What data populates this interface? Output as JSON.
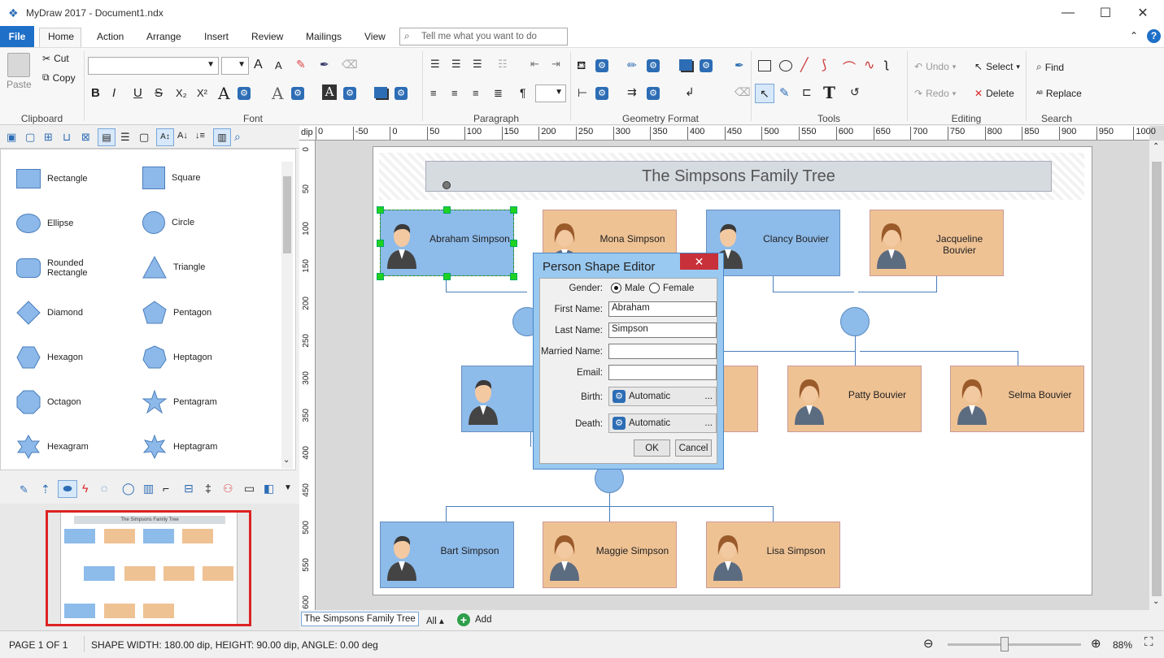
{
  "app": {
    "title": "MyDraw 2017 - Document1.ndx",
    "minimize": "—",
    "maximize": "☐",
    "close": "✕"
  },
  "menu": {
    "file": "File",
    "tabs": [
      "Home",
      "Action",
      "Arrange",
      "Insert",
      "Review",
      "Mailings",
      "View"
    ],
    "search_placeholder": "Tell me what you want to do"
  },
  "ribbon": {
    "clipboard": {
      "label": "Clipboard",
      "paste": "Paste",
      "cut": "Cut",
      "copy": "Copy"
    },
    "font": {
      "label": "Font"
    },
    "paragraph": {
      "label": "Paragraph"
    },
    "geometry": {
      "label": "Geometry Format"
    },
    "tools": {
      "label": "Tools"
    },
    "editing": {
      "label": "Editing",
      "undo": "Undo",
      "redo": "Redo",
      "select": "Select",
      "delete": "Delete"
    },
    "search": {
      "label": "Search",
      "find": "Find",
      "replace": "Replace"
    }
  },
  "shapes": [
    {
      "name": "Rectangle"
    },
    {
      "name": "Square"
    },
    {
      "name": "Ellipse"
    },
    {
      "name": "Circle"
    },
    {
      "name": "Rounded Rectangle"
    },
    {
      "name": "Triangle"
    },
    {
      "name": "Diamond"
    },
    {
      "name": "Pentagon"
    },
    {
      "name": "Hexagon"
    },
    {
      "name": "Heptagon"
    },
    {
      "name": "Octagon"
    },
    {
      "name": "Pentagram"
    },
    {
      "name": "Hexagram"
    },
    {
      "name": "Heptagram"
    }
  ],
  "ruler": {
    "unit": "dip",
    "top": [
      "0",
      "-50",
      "0",
      "50",
      "100",
      "150",
      "200",
      "250",
      "300",
      "350",
      "400",
      "450",
      "500",
      "550",
      "600",
      "650",
      "700",
      "750",
      "800",
      "850",
      "900",
      "950",
      "1000"
    ],
    "left": [
      "0",
      "50",
      "100",
      "150",
      "200",
      "250",
      "300",
      "350",
      "400",
      "450",
      "500",
      "550",
      "600"
    ]
  },
  "diagram": {
    "title": "The Simpsons Family Tree",
    "people": [
      {
        "name": "Abraham Simpson",
        "gender": "male"
      },
      {
        "name": "Mona Simpson",
        "gender": "female"
      },
      {
        "name": "Clancy Bouvier",
        "gender": "male"
      },
      {
        "name": "Jacqueline Bouvier",
        "gender": "female"
      },
      {
        "name": "Home",
        "gender": "male"
      },
      {
        "name": "pson",
        "gender": "female"
      },
      {
        "name": "Patty Bouvier",
        "gender": "female"
      },
      {
        "name": "Selma Bouvier",
        "gender": "female"
      },
      {
        "name": "Bart Simpson",
        "gender": "male"
      },
      {
        "name": "Maggie Simpson",
        "gender": "female"
      },
      {
        "name": "Lisa Simpson",
        "gender": "female"
      }
    ]
  },
  "dialog": {
    "title": "Person Shape Editor",
    "close": "✕",
    "gender_label": "Gender:",
    "male": "Male",
    "female": "Female",
    "first_name_label": "First Name:",
    "first_name": "Abraham",
    "last_name_label": "Last Name:",
    "last_name": "Simpson",
    "married_name_label": "Married Name:",
    "married_name": "",
    "email_label": "Email:",
    "email": "",
    "birth_label": "Birth:",
    "birth": "Automatic",
    "death_label": "Death:",
    "death": "Automatic",
    "ellipsis": "...",
    "ok": "OK",
    "cancel": "Cancel"
  },
  "tabs": {
    "page_tab": "The Simpsons Family Tree",
    "all": "All ▴",
    "add": "Add"
  },
  "overview": {
    "title": "The Simpsons Family Tree"
  },
  "status": {
    "page": "PAGE 1 OF 1",
    "shape_info": "SHAPE WIDTH: 180.00 dip, HEIGHT: 90.00 dip, ANGLE: 0.00 deg",
    "zoom": "88%",
    "zoom_level": 0.88
  },
  "colors": {
    "male": "#8dbbea",
    "female": "#efc294",
    "accent": "#1e6fc8",
    "close": "#c8303a"
  }
}
